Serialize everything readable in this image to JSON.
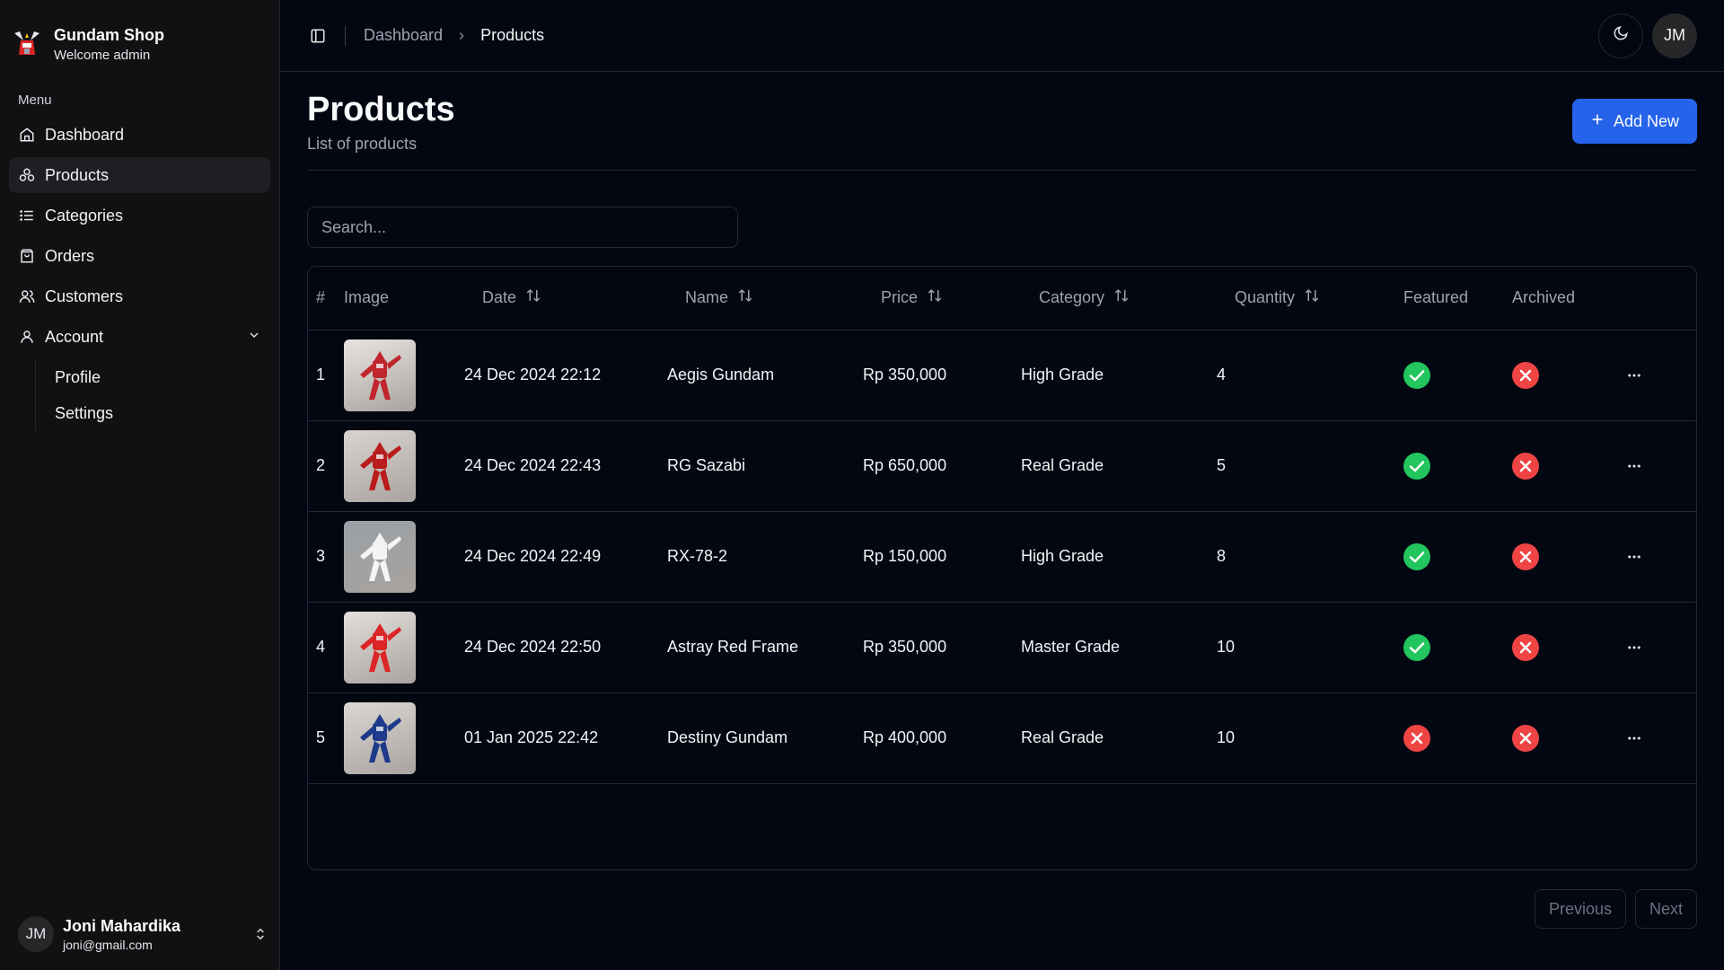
{
  "brand": {
    "title": "Gundam Shop",
    "subtitle": "Welcome admin"
  },
  "menu": {
    "label": "Menu",
    "items": [
      {
        "label": "Dashboard",
        "icon": "home-icon"
      },
      {
        "label": "Products",
        "icon": "boxes-icon",
        "active": true
      },
      {
        "label": "Categories",
        "icon": "list-icon"
      },
      {
        "label": "Orders",
        "icon": "shopping-bag-icon"
      },
      {
        "label": "Customers",
        "icon": "users-icon"
      },
      {
        "label": "Account",
        "icon": "user-icon",
        "expanded": true
      }
    ],
    "account_subitems": [
      {
        "label": "Profile"
      },
      {
        "label": "Settings"
      }
    ]
  },
  "user": {
    "initials": "JM",
    "name": "Joni Mahardika",
    "email": "joni@gmail.com"
  },
  "topbar": {
    "breadcrumb": [
      "Dashboard",
      "Products"
    ],
    "avatar_initials": "JM"
  },
  "page": {
    "title": "Products",
    "subtitle": "List of products",
    "add_button": "Add New"
  },
  "search": {
    "placeholder": "Search...",
    "value": ""
  },
  "table": {
    "columns": [
      "#",
      "Image",
      "Date",
      "Name",
      "Price",
      "Category",
      "Quantity",
      "Featured",
      "Archived"
    ],
    "rows": [
      {
        "no": "1",
        "date": "24 Dec 2024 22:12",
        "name": "Aegis Gundam",
        "price": "Rp 350,000",
        "category": "High Grade",
        "quantity": "4",
        "featured": true,
        "archived": false
      },
      {
        "no": "2",
        "date": "24 Dec 2024 22:43",
        "name": "RG Sazabi",
        "price": "Rp 650,000",
        "category": "Real Grade",
        "quantity": "5",
        "featured": true,
        "archived": false
      },
      {
        "no": "3",
        "date": "24 Dec 2024 22:49",
        "name": "RX-78-2",
        "price": "Rp 150,000",
        "category": "High Grade",
        "quantity": "8",
        "featured": true,
        "archived": false
      },
      {
        "no": "4",
        "date": "24 Dec 2024 22:50",
        "name": "Astray Red Frame",
        "price": "Rp 350,000",
        "category": "Master Grade",
        "quantity": "10",
        "featured": true,
        "archived": false
      },
      {
        "no": "5",
        "date": "01 Jan 2025 22:42",
        "name": "Destiny Gundam",
        "price": "Rp 400,000",
        "category": "Real Grade",
        "quantity": "10",
        "featured": false,
        "archived": false
      }
    ]
  },
  "pagination": {
    "previous": "Previous",
    "next": "Next"
  },
  "colors": {
    "accent": "#2563eb",
    "success": "#22c55e",
    "danger": "#ef4444",
    "background": "#030712",
    "sidebar": "#111113"
  }
}
